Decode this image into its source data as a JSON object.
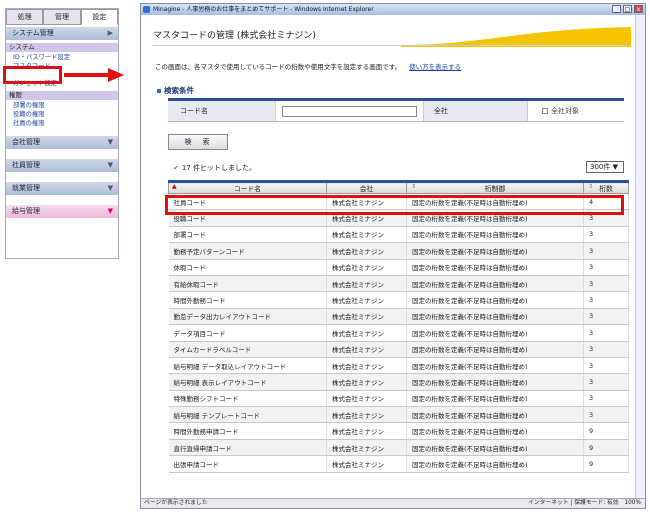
{
  "sidebar": {
    "tabs": [
      "処理",
      "管理",
      "設定"
    ],
    "system_header": "システム管理",
    "group_system": "システム",
    "system_links": [
      "ID・パスワード設定",
      "マスタコード"
    ],
    "gadget": "ガジェット設定",
    "group_auth": "権限",
    "auth_links": [
      "部署の権限",
      "役職の権限",
      "社員の権限"
    ],
    "company": "会社管理",
    "employee": "社員管理",
    "attendance": "就業管理",
    "payroll": "給与管理"
  },
  "window": {
    "title": "Minagine - 人事労務のお仕事をまとめてサポート - Windows Internet Explorer",
    "status_left": "ページが表示されました",
    "status_right": "インターネット | 保護モード: 有効",
    "zoom": "100%"
  },
  "page": {
    "title": "マスタコードの管理 (株式会社ミナジン)",
    "description": "この画面は、各マスタで使用しているコードの桁数や使用文字を設定する画面です。",
    "help_link": "使い方を表示する",
    "search_title": "検索条件",
    "label_code": "コード名",
    "label_company": "全社",
    "label_all": "全社対象",
    "search_button": "検　索",
    "hits": "17 件ヒットしました。",
    "page_size": "300件 ▼"
  },
  "table": {
    "headers": [
      "コード名",
      "会社",
      "桁制御",
      "桁数"
    ],
    "rows": [
      [
        "社員コード",
        "株式会社ミナジン",
        "固定の桁数を定義(不足時は自動桁埋め)",
        "4"
      ],
      [
        "役職コード",
        "株式会社ミナジン",
        "固定の桁数を定義(不足時は自動桁埋め)",
        "3"
      ],
      [
        "部署コード",
        "株式会社ミナジン",
        "固定の桁数を定義(不足時は自動桁埋め)",
        "3"
      ],
      [
        "勤務予定パターンコード",
        "株式会社ミナジン",
        "固定の桁数を定義(不足時は自動桁埋め)",
        "3"
      ],
      [
        "休暇コード",
        "株式会社ミナジン",
        "固定の桁数を定義(不足時は自動桁埋め)",
        "3"
      ],
      [
        "有給休暇コード",
        "株式会社ミナジン",
        "固定の桁数を定義(不足時は自動桁埋め)",
        "3"
      ],
      [
        "時間外勤務コード",
        "株式会社ミナジン",
        "固定の桁数を定義(不足時は自動桁埋め)",
        "3"
      ],
      [
        "勤怠データ出力レイアウトコード",
        "株式会社ミナジン",
        "固定の桁数を定義(不足時は自動桁埋め)",
        "3"
      ],
      [
        "データ項目コード",
        "株式会社ミナジン",
        "固定の桁数を定義(不足時は自動桁埋め)",
        "3"
      ],
      [
        "タイムカードラベルコード",
        "株式会社ミナジン",
        "固定の桁数を定義(不足時は自動桁埋め)",
        "3"
      ],
      [
        "給与明細 データ取込レイアウトコード",
        "株式会社ミナジン",
        "固定の桁数を定義(不足時は自動桁埋め)",
        "3"
      ],
      [
        "給与明細 表示レイアウトコード",
        "株式会社ミナジン",
        "固定の桁数を定義(不足時は自動桁埋め)",
        "3"
      ],
      [
        "特殊勤務シフトコード",
        "株式会社ミナジン",
        "固定の桁数を定義(不足時は自動桁埋め)",
        "3"
      ],
      [
        "給与明細 テンプレートコード",
        "株式会社ミナジン",
        "固定の桁数を定義(不足時は自動桁埋め)",
        "3"
      ],
      [
        "時間外勤務申請コード",
        "株式会社ミナジン",
        "固定の桁数を定義(不足時は自動桁埋め)",
        "9"
      ],
      [
        "直行直帰申請コード",
        "株式会社ミナジン",
        "固定の桁数を定義(不足時は自動桁埋め)",
        "9"
      ],
      [
        "出張申請コード",
        "株式会社ミナジン",
        "固定の桁数を定義(不足時は自動桁埋め)",
        "9"
      ]
    ]
  }
}
